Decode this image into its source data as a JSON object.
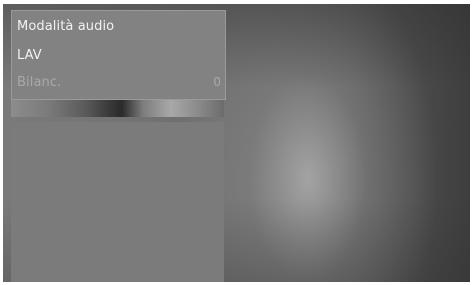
{
  "menu": {
    "title": "Modalità audio",
    "items": [
      {
        "label": "LAV",
        "value": ""
      },
      {
        "label": "Bilanc.",
        "value": "0"
      }
    ]
  }
}
